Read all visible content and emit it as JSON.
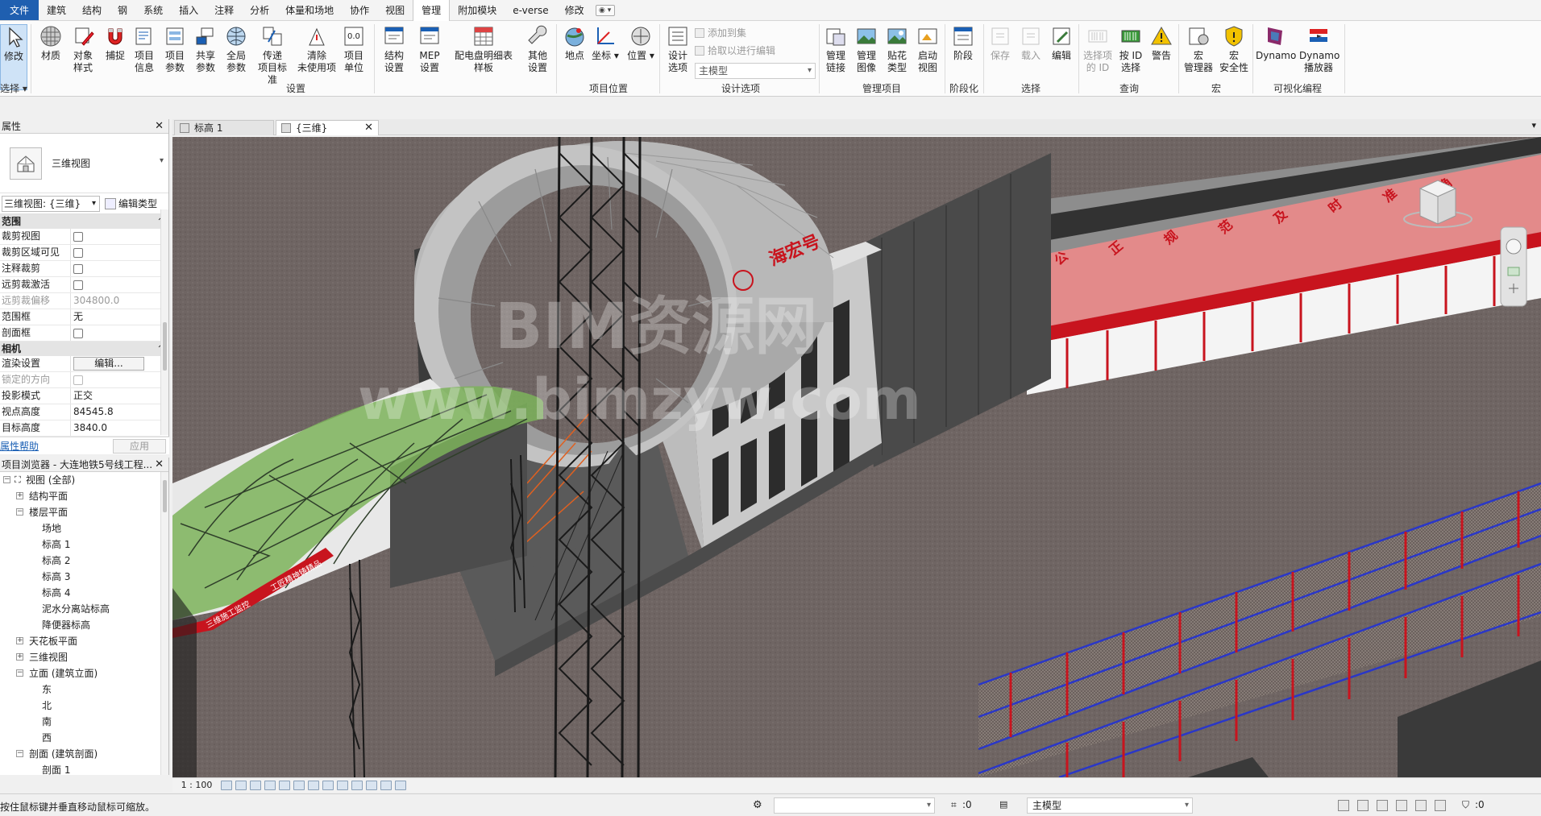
{
  "menu": {
    "tabs": [
      "文件",
      "建筑",
      "结构",
      "钢",
      "系统",
      "插入",
      "注释",
      "分析",
      "体量和场地",
      "协作",
      "视图",
      "管理",
      "附加模块",
      "e-verse",
      "修改"
    ],
    "active": "管理"
  },
  "ribbon": {
    "buttons": {
      "modify": "修改",
      "materials": "材质",
      "object_styles": "对象\n样式",
      "snaps": "捕捉",
      "project_info": "项目\n信息",
      "project_params": "项目\n参数",
      "shared_params": "共享\n参数",
      "global_params": "全局\n参数",
      "transfer_standards": "传递\n项目标准",
      "purge_unused": "清除\n未使用项",
      "project_units": "项目\n单位",
      "struct_settings": "结构\n设置",
      "mep_settings": "MEP\n设置",
      "panel_schedule": "配电盘明细表\n样板",
      "other_settings": "其他\n设置",
      "location": "地点",
      "coordinates": "坐标",
      "position": "位置",
      "design_options": "设计\n选项",
      "manage_links": "管理\n链接",
      "manage_images": "管理\n图像",
      "decal_types": "贴花\n类型",
      "starting_view": "启动\n视图",
      "phases": "阶段",
      "save_sel": "保存",
      "load_sel": "载入",
      "edit_sel": "编辑",
      "ids_of_sel": "选择项\n的 ID",
      "select_by_id": "按 ID\n选择",
      "warnings": "警告",
      "macro_manager": "宏\n管理器",
      "macro_security": "宏\n安全性",
      "dynamo": "Dynamo",
      "dynamo_player": "Dynamo\n播放器"
    },
    "select_label": "选择",
    "add_to_set": "添加到集",
    "pick_to_edit": "拾取以进行编辑",
    "design_option_value": "主模型",
    "groups": {
      "settings": "设置",
      "project_location": "项目位置",
      "design_options": "设计选项",
      "manage_project": "管理项目",
      "phasing": "阶段化",
      "selection": "选择",
      "inquiry": "查询",
      "macros": "宏",
      "visual_programming": "可视化编程"
    }
  },
  "properties": {
    "title": "属性",
    "type_name": "三维视图",
    "filter_value": "三维视图: {三维}",
    "edit_type": "编辑类型",
    "sections": {
      "extents": "范围",
      "camera": "相机"
    },
    "extents_rows": [
      {
        "key": "裁剪视图",
        "value": ""
      },
      {
        "key": "裁剪区域可见",
        "value": ""
      },
      {
        "key": "注释裁剪",
        "value": ""
      },
      {
        "key": "远剪裁激活",
        "value": ""
      },
      {
        "key": "远剪裁偏移",
        "value": "304800.0"
      },
      {
        "key": "范围框",
        "value": "无"
      },
      {
        "key": "剖面框",
        "value": ""
      }
    ],
    "camera_rows": [
      {
        "key": "渲染设置",
        "value": "编辑..."
      },
      {
        "key": "锁定的方向",
        "value": ""
      },
      {
        "key": "投影模式",
        "value": "正交"
      },
      {
        "key": "视点高度",
        "value": "84545.8"
      },
      {
        "key": "目标高度",
        "value": "3840.0"
      }
    ],
    "help": "属性帮助",
    "apply": "应用"
  },
  "browser": {
    "title": "项目浏览器 - 大连地铁5号线工程...",
    "nodes": [
      {
        "label": "视图 (全部)",
        "level": 0,
        "toggle": "−"
      },
      {
        "label": "结构平面",
        "level": 1,
        "toggle": "+"
      },
      {
        "label": "楼层平面",
        "level": 1,
        "toggle": "−"
      },
      {
        "label": "场地",
        "level": 2,
        "toggle": ""
      },
      {
        "label": "标高 1",
        "level": 2,
        "toggle": ""
      },
      {
        "label": "标高 2",
        "level": 2,
        "toggle": ""
      },
      {
        "label": "标高 3",
        "level": 2,
        "toggle": ""
      },
      {
        "label": "标高 4",
        "level": 2,
        "toggle": ""
      },
      {
        "label": "泥水分离站标高",
        "level": 2,
        "toggle": ""
      },
      {
        "label": "降便器标高",
        "level": 2,
        "toggle": ""
      },
      {
        "label": "天花板平面",
        "level": 1,
        "toggle": "+"
      },
      {
        "label": "三维视图",
        "level": 1,
        "toggle": "+"
      },
      {
        "label": "立面 (建筑立面)",
        "level": 1,
        "toggle": "−"
      },
      {
        "label": "东",
        "level": 2,
        "toggle": ""
      },
      {
        "label": "北",
        "level": 2,
        "toggle": ""
      },
      {
        "label": "南",
        "level": 2,
        "toggle": ""
      },
      {
        "label": "西",
        "level": 2,
        "toggle": ""
      },
      {
        "label": "剖面 (建筑剖面)",
        "level": 1,
        "toggle": "−"
      },
      {
        "label": "剖面 1",
        "level": 2,
        "toggle": ""
      }
    ]
  },
  "view_tabs": [
    {
      "label": "标高 1",
      "active": false
    },
    {
      "label": "{三维}",
      "active": true
    }
  ],
  "viewport": {
    "sign_text": "海宏号",
    "watermark_line1": "BIM资源网",
    "watermark_line2": "www.bimzyw.com",
    "slogan_chars": [
      "公",
      "正",
      "规",
      "范",
      "及",
      "时",
      "准",
      "确"
    ],
    "banner_left": "三维施工监控",
    "banner_right": "工匠精神铸精品"
  },
  "view_control": {
    "scale": "1 : 100"
  },
  "status": {
    "message": "按住鼠标键并垂直移动鼠标可缩放。",
    "coord": ":0",
    "model": "主模型",
    "filter_count": ":0"
  },
  "colors": {
    "file_tab": "#1f5fb0",
    "ground": "#6f6563",
    "canopy_green": "#7db35a",
    "roof_pink": "#e08888",
    "fence_blue": "#2a37c8",
    "accent_red": "#c8141e"
  }
}
